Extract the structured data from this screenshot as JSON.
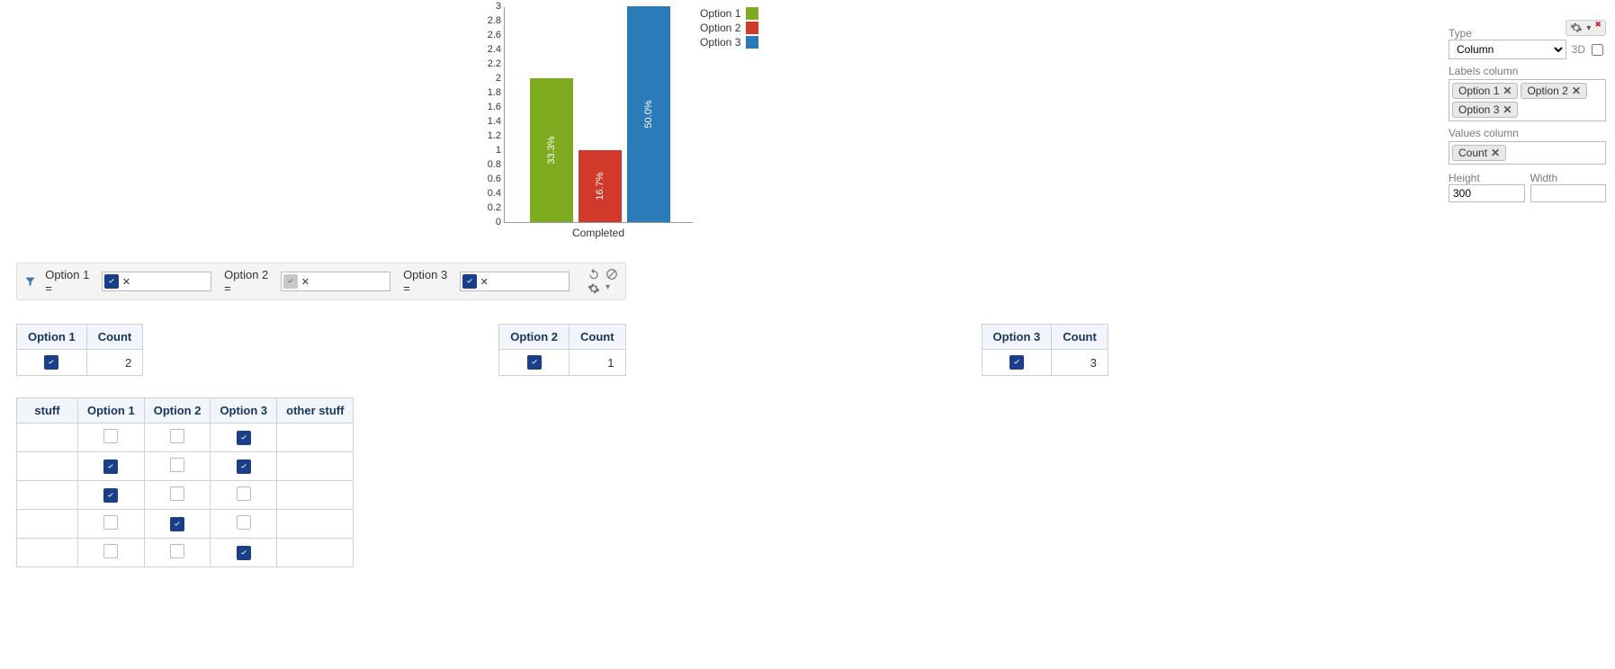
{
  "chart_data": {
    "type": "bar",
    "categories": [
      "Completed"
    ],
    "series": [
      {
        "name": "Option 1",
        "value": 2,
        "pct": "33.3%",
        "color": "#7eab1f"
      },
      {
        "name": "Option 2",
        "value": 1,
        "pct": "16.7%",
        "color": "#d1392b"
      },
      {
        "name": "Option 3",
        "value": 3,
        "pct": "50.0%",
        "color": "#2b7bb9"
      }
    ],
    "ylim": [
      0,
      3
    ],
    "yticks": [
      0,
      0.2,
      0.4,
      0.6,
      0.8,
      1,
      1.2,
      1.4,
      1.6,
      1.8,
      2,
      2.2,
      2.4,
      2.6,
      2.8,
      3
    ],
    "xlabel": "Completed"
  },
  "legend": [
    "Option 1",
    "Option 2",
    "Option 3"
  ],
  "props": {
    "type_label": "Type",
    "type_value": "Column",
    "threeD_label": "3D",
    "threeD_checked": false,
    "labels_label": "Labels column",
    "labels_tags": [
      "Option 1",
      "Option 2",
      "Option 3"
    ],
    "values_label": "Values column",
    "values_tags": [
      "Count"
    ],
    "height_label": "Height",
    "width_label": "Width",
    "height_value": "300",
    "width_value": ""
  },
  "filter": {
    "groups": [
      {
        "label": "Option 1 =",
        "checked": true
      },
      {
        "label": "Option 2 =",
        "checked_gray": true
      },
      {
        "label": "Option 3 =",
        "checked": true
      }
    ]
  },
  "counts": [
    {
      "header": "Option 1",
      "count_header": "Count",
      "checked": true,
      "count": "2"
    },
    {
      "header": "Option 2",
      "count_header": "Count",
      "checked": true,
      "count": "1"
    },
    {
      "header": "Option 3",
      "count_header": "Count",
      "checked": true,
      "count": "3"
    }
  ],
  "wide": {
    "headers": [
      "stuff",
      "Option 1",
      "Option 2",
      "Option 3",
      "other stuff"
    ],
    "rows": [
      {
        "o1": false,
        "o2": false,
        "o3": true
      },
      {
        "o1": true,
        "o2": false,
        "o3": true
      },
      {
        "o1": true,
        "o2": false,
        "o3": false
      },
      {
        "o1": false,
        "o2": true,
        "o3": false
      },
      {
        "o1": false,
        "o2": false,
        "o3": true
      }
    ]
  }
}
